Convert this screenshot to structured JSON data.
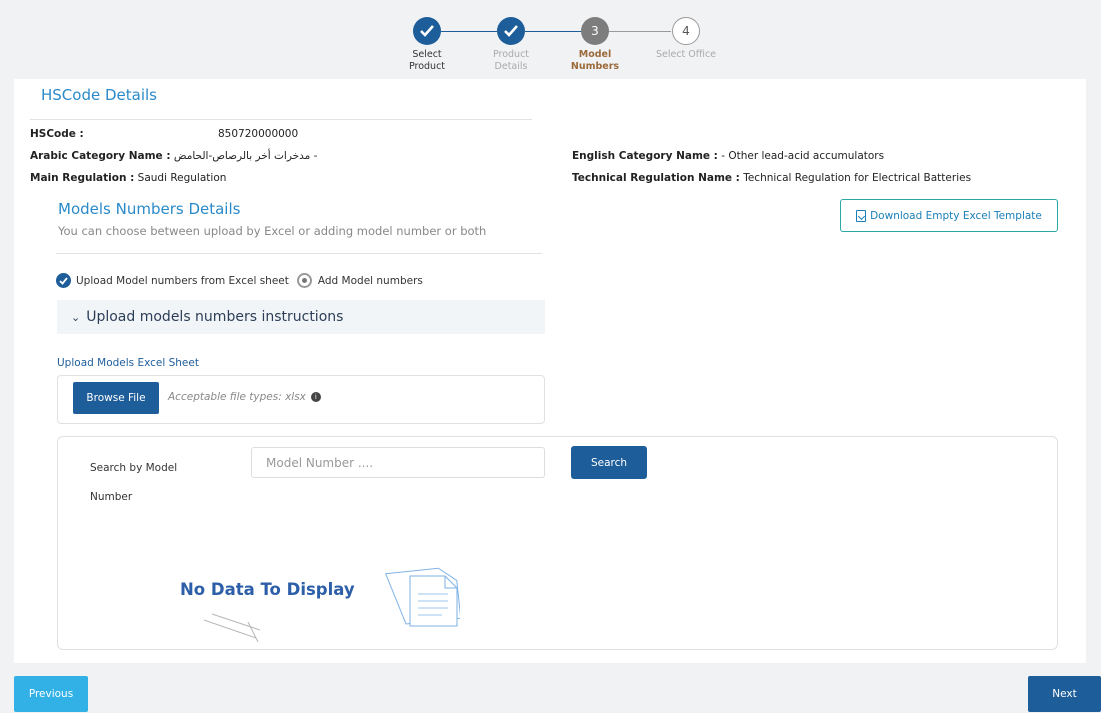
{
  "stepper": {
    "steps": [
      {
        "label_line1": "Select",
        "label_line2": "Product",
        "state": "done"
      },
      {
        "label_line1": "Product",
        "label_line2": "Details",
        "state": "done"
      },
      {
        "number": "3",
        "label_line1": "Model Numbers",
        "label_line2": "",
        "state": "current"
      },
      {
        "number": "4",
        "label_line1": "Select Office",
        "label_line2": "",
        "state": "todo"
      }
    ]
  },
  "hscode": {
    "section_title": "HSCode Details",
    "hscode_label": "HSCode :",
    "hscode_value": "850720000000",
    "arabic_label": "Arabic Category Name :",
    "arabic_value": "- مدخرات أخر بالرصاص-الحامض",
    "english_label": "English Category Name :",
    "english_value": "- Other lead-acid accumulators",
    "main_reg_label": "Main Regulation :",
    "main_reg_value": "Saudi Regulation",
    "tech_reg_label": "Technical Regulation Name :",
    "tech_reg_value": "Technical Regulation for Electrical Batteries"
  },
  "models": {
    "section_title": "Models Numbers Details",
    "subtitle": "You can choose between upload by Excel or adding model number or both",
    "download_button": "Download Empty Excel Template",
    "radio_excel": "Upload Model numbers from Excel sheet",
    "radio_add": "Add Model numbers",
    "accordion_label": "Upload models numbers instructions",
    "upload_label": "Upload Models Excel Sheet",
    "browse_button": "Browse File",
    "acceptable_types": "Acceptable file types: xlsx"
  },
  "search": {
    "label": "Search by Model Number",
    "placeholder": "Model Number ....",
    "button": "Search",
    "empty_message": "No Data To Display"
  },
  "footer": {
    "previous": "Previous",
    "next": "Next"
  },
  "colors": {
    "primary": "#1d5d9a",
    "accent": "#2a8ac9",
    "previous_bg": "#32b1e6"
  }
}
